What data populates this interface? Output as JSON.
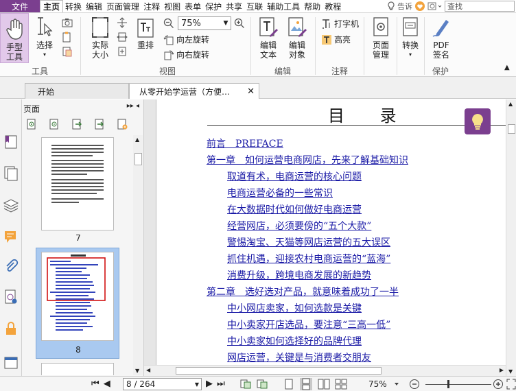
{
  "menu": {
    "file": "文件",
    "items": [
      "主页",
      "转换",
      "编辑",
      "页面管理",
      "注释",
      "视图",
      "表单",
      "保护",
      "共享",
      "互联",
      "辅助工具",
      "帮助",
      "教程"
    ],
    "active_index": 0,
    "tell_me": "告诉",
    "search_placeholder": "查找"
  },
  "ribbon": {
    "hand_tool": "手型\n工具",
    "select": "选择",
    "group_tools": "工具",
    "actual_size": "实际\n大小",
    "reflow": "重排",
    "zoom_value": "75%",
    "rotate_left": "向左旋转",
    "rotate_right": "向右旋转",
    "group_view": "视图",
    "edit_text": "编辑\n文本",
    "edit_object": "编辑\n对象",
    "group_edit": "编辑",
    "typewriter": "打字机",
    "highlight": "高亮",
    "group_comment": "注释",
    "page_manage": "页面\n管理",
    "convert": "转换",
    "pdf_sign": "PDF\n签名",
    "group_protect": "保护"
  },
  "tabs": {
    "start": "开始",
    "document": "从零开始学运营（方便…"
  },
  "panel": {
    "title": "页面",
    "thumb_labels": [
      "7",
      "8"
    ],
    "selected": "8"
  },
  "document": {
    "title": "目 录",
    "toc": [
      {
        "text": "前言　PREFACE",
        "level": 0
      },
      {
        "text": "第一章　如何运营电商网店，先来了解基础知识",
        "level": 0
      },
      {
        "text": "取道有术，电商运营的核心问题",
        "level": 1
      },
      {
        "text": "电商运营必备的一些常识",
        "level": 1
      },
      {
        "text": "在大数据时代如何做好电商运营",
        "level": 1
      },
      {
        "text": "经营网店，必须要傍的“五个大款”",
        "level": 1
      },
      {
        "text": "警惕淘宝、天猫等网店运营的五大误区",
        "level": 1
      },
      {
        "text": "抓住机遇，迎接农村电商运营的“蓝海”",
        "level": 1
      },
      {
        "text": "消费升级，跨境电商发展的新趋势",
        "level": 1
      },
      {
        "text": "第二章　选好选对产品，就意味着成功了一半",
        "level": 0
      },
      {
        "text": "中小网店卖家，如何选款是关键",
        "level": 1
      },
      {
        "text": "中小卖家开店选品，要注意“三高一低”",
        "level": 1
      },
      {
        "text": "中小卖家如何选择好的品牌代理",
        "level": 1
      },
      {
        "text": "网店运营，关键是与消费者交朋友",
        "level": 1
      }
    ]
  },
  "status": {
    "page_indicator": "8 / 264",
    "zoom": "75%"
  },
  "colors": {
    "brand": "#7b3f8f",
    "link": "#1a1aa6",
    "selection": "#a9c9f0",
    "red_box": "#d01010"
  }
}
